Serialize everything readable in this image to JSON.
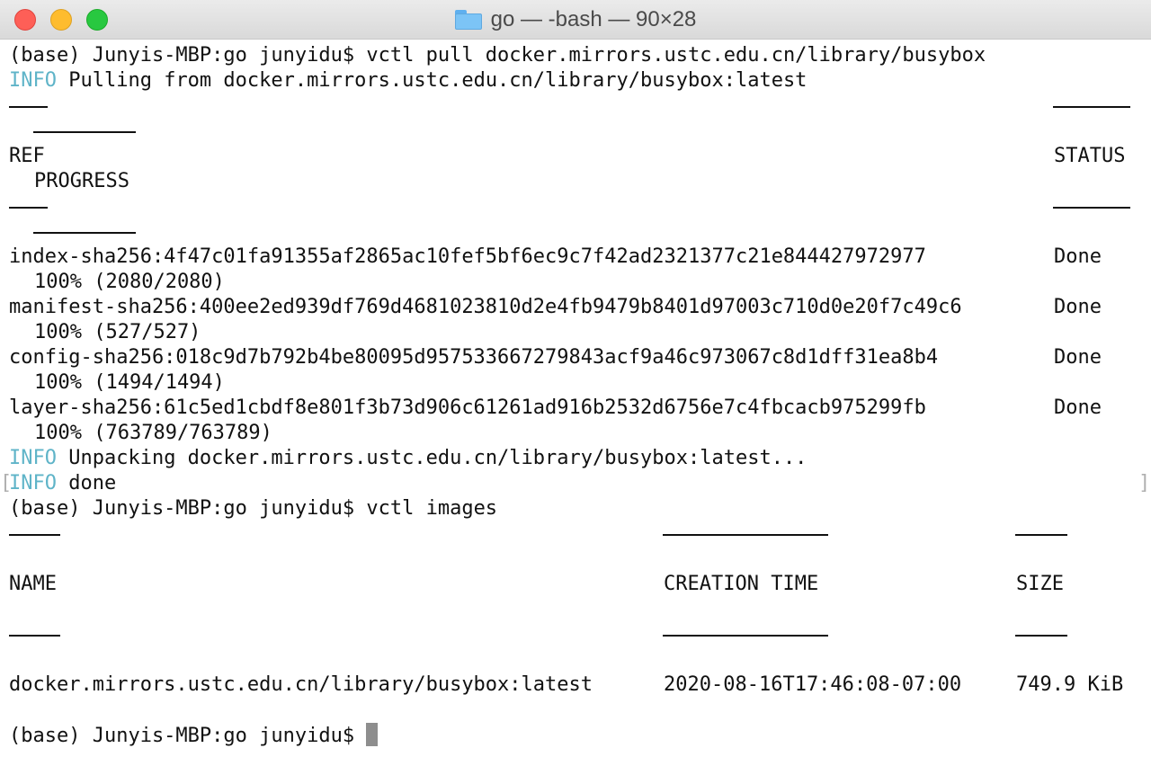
{
  "window": {
    "title": "go — -bash — 90×28"
  },
  "terminal": {
    "prompt": "(base) Junyis-MBP:go junyidu$",
    "pull_command": "vctl pull docker.mirrors.ustc.edu.cn/library/busybox",
    "info_tag": "INFO",
    "pull_info": "Pulling from docker.mirrors.ustc.edu.cn/library/busybox:latest",
    "pull_headers": {
      "ref": "REF",
      "status": "STATUS",
      "progress": "PROGRESS"
    },
    "pull_rows": [
      {
        "ref": "index-sha256:4f47c01fa91355af2865ac10fef5bf6ec9c7f42ad2321377c21e844427972977",
        "status": "Done",
        "progress": "100% (2080/2080)"
      },
      {
        "ref": "manifest-sha256:400ee2ed939df769d4681023810d2e4fb9479b8401d97003c710d0e20f7c49c6",
        "status": "Done",
        "progress": "100% (527/527)"
      },
      {
        "ref": "config-sha256:018c9d7b792b4be80095d957533667279843acf9a46c973067c8d1dff31ea8b4",
        "status": "Done",
        "progress": "100% (1494/1494)"
      },
      {
        "ref": "layer-sha256:61c5ed1cbdf8e801f3b73d906c61261ad916b2532d6756e7c4fbcacb975299fb",
        "status": "Done",
        "progress": "100% (763789/763789)"
      }
    ],
    "unpack_info": "Unpacking docker.mirrors.ustc.edu.cn/library/busybox:latest...",
    "done_info": "done",
    "images_command": "vctl images",
    "images_headers": {
      "name": "NAME",
      "creation_time": "CREATION TIME",
      "size": "SIZE"
    },
    "images_rows": [
      {
        "name": "docker.mirrors.ustc.edu.cn/library/busybox:latest",
        "creation_time": "2020-08-16T17:46:08-07:00",
        "size": "749.9 KiB"
      }
    ],
    "side_marks": {
      "left": "[",
      "right": "]"
    }
  }
}
